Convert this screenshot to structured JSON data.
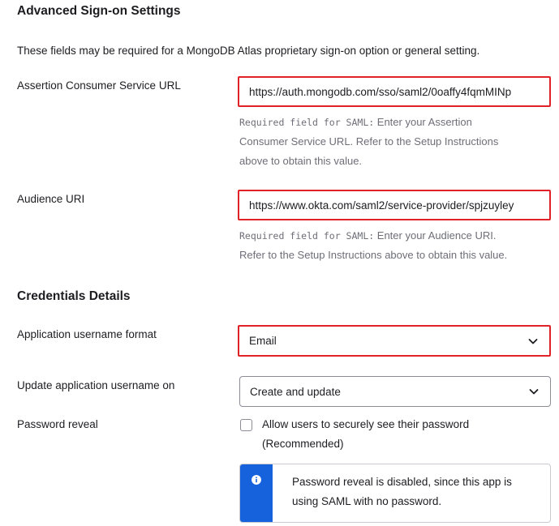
{
  "advanced": {
    "title": "Advanced Sign-on Settings",
    "description": "These fields may be required for a MongoDB Atlas proprietary sign-on option or general setting.",
    "acs": {
      "label": "Assertion Consumer Service URL",
      "value": "https://auth.mongodb.com/sso/saml2/0oaffy4fqmMINp",
      "help_prefix": "Required field for SAML:",
      "help_line1": " Enter your Assertion",
      "help_line2": "Consumer Service URL. Refer to the Setup Instructions",
      "help_line3": "above to obtain this value."
    },
    "audience": {
      "label": "Audience URI",
      "value": "https://www.okta.com/saml2/service-provider/spjzuyley",
      "help_prefix": "Required field for SAML:",
      "help_line1": " Enter your Audience URI.",
      "help_line2": "Refer to the Setup Instructions above to obtain this value."
    }
  },
  "credentials": {
    "title": "Credentials Details",
    "username_format": {
      "label": "Application username format",
      "value": "Email"
    },
    "update_username": {
      "label": "Update application username on",
      "value": "Create and update"
    },
    "password_reveal": {
      "label": "Password reveal",
      "checkbox_line1": "Allow users to securely see their password",
      "checkbox_line2": "(Recommended)",
      "checked": false
    },
    "callout": {
      "line1": "Password reveal is disabled, since this app is",
      "line2": "using SAML with no password."
    }
  },
  "colors": {
    "highlight": "#e12128",
    "info": "#1662dd"
  },
  "icons": {
    "select": "chevron-down-icon",
    "callout": "info-icon"
  }
}
